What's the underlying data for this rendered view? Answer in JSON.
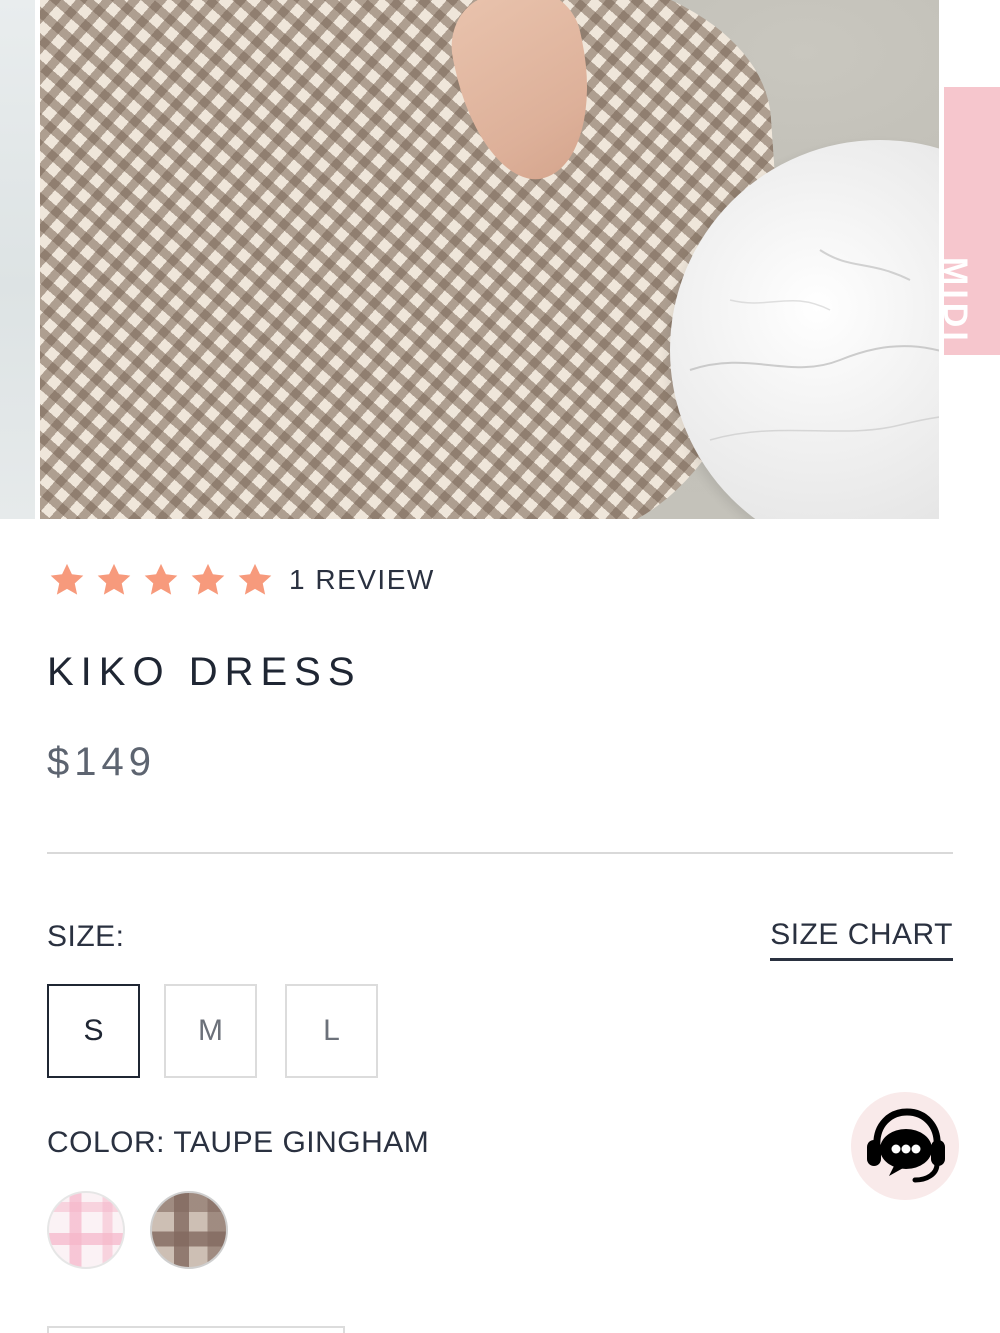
{
  "gallery": {
    "next_slide_label": "MIDI"
  },
  "product": {
    "rating": {
      "stars": 5,
      "max_stars": 5,
      "review_count_label": "1 REVIEW"
    },
    "title": "KIKO DRESS",
    "price": "$149"
  },
  "size": {
    "label": "SIZE:",
    "chart_link": "SIZE CHART",
    "options": [
      "S",
      "M",
      "L"
    ],
    "selected": "S"
  },
  "color": {
    "label": "COLOR: TAUPE GINGHAM",
    "swatches": [
      {
        "name": "pink gingham",
        "base_color": "#fbf2f5",
        "check_color": "#f5b4c8"
      },
      {
        "name": "taupe gingham",
        "base_color": "#cdbfb4",
        "check_color": "#82695f"
      }
    ],
    "selected": "taupe gingham"
  },
  "colors": {
    "star": "#f79a7c",
    "text": "#1f2633",
    "price": "#5d6470",
    "accent_pink": "#f6c6cd",
    "chat_bg": "#f9eaea"
  },
  "icons": {
    "star": "star-icon",
    "chat": "support-chat-icon"
  }
}
